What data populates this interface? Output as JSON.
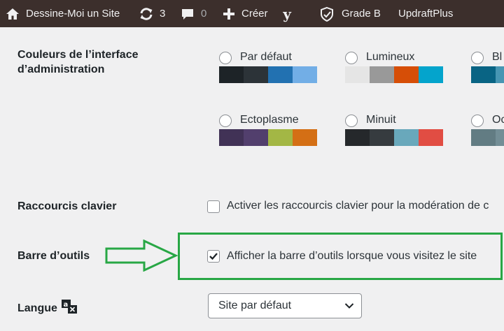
{
  "adminbar": {
    "site_name": "Dessine-Moi un Site",
    "updates_count": "3",
    "comments_count": "0",
    "new_label": "Créer",
    "yoast_label": "y",
    "security_label": "Grade B",
    "updraft_label": "UpdraftPlus"
  },
  "admin_colors": {
    "label": "Couleurs de l’interface d’administration",
    "label_line1": "Couleurs de l’interface",
    "label_line2": "d’administration",
    "schemes": [
      {
        "name": "Par défaut",
        "colors": [
          "#1d2327",
          "#2c3338",
          "#2271b1",
          "#72aee6"
        ]
      },
      {
        "name": "Lumineux",
        "colors": [
          "#e5e5e5",
          "#999999",
          "#d64e07",
          "#04a4cc"
        ]
      },
      {
        "name": "Bl",
        "colors": [
          "#096484",
          "#4796b3",
          "#52accc",
          "#74b6ce"
        ]
      },
      {
        "name": "Ectoplasme",
        "colors": [
          "#413256",
          "#523f6d",
          "#a3b745",
          "#d46f15"
        ]
      },
      {
        "name": "Minuit",
        "colors": [
          "#25282b",
          "#363b3f",
          "#69a8bb",
          "#e14d43"
        ]
      },
      {
        "name": "Oc",
        "colors": [
          "#627c83",
          "#738e96",
          "#9ebaa0",
          "#aa9d88"
        ]
      }
    ]
  },
  "keyboard": {
    "label": "Raccourcis clavier",
    "checkbox_text": "Activer les raccourcis clavier pour la modération de c"
  },
  "toolbar": {
    "label": "Barre d’outils",
    "checkbox_text": "Afficher la barre d’outils lorsque vous visitez le site",
    "checked": true,
    "highlight_color": "#28a745"
  },
  "language": {
    "label": "Langue",
    "selected": "Site par défaut"
  }
}
